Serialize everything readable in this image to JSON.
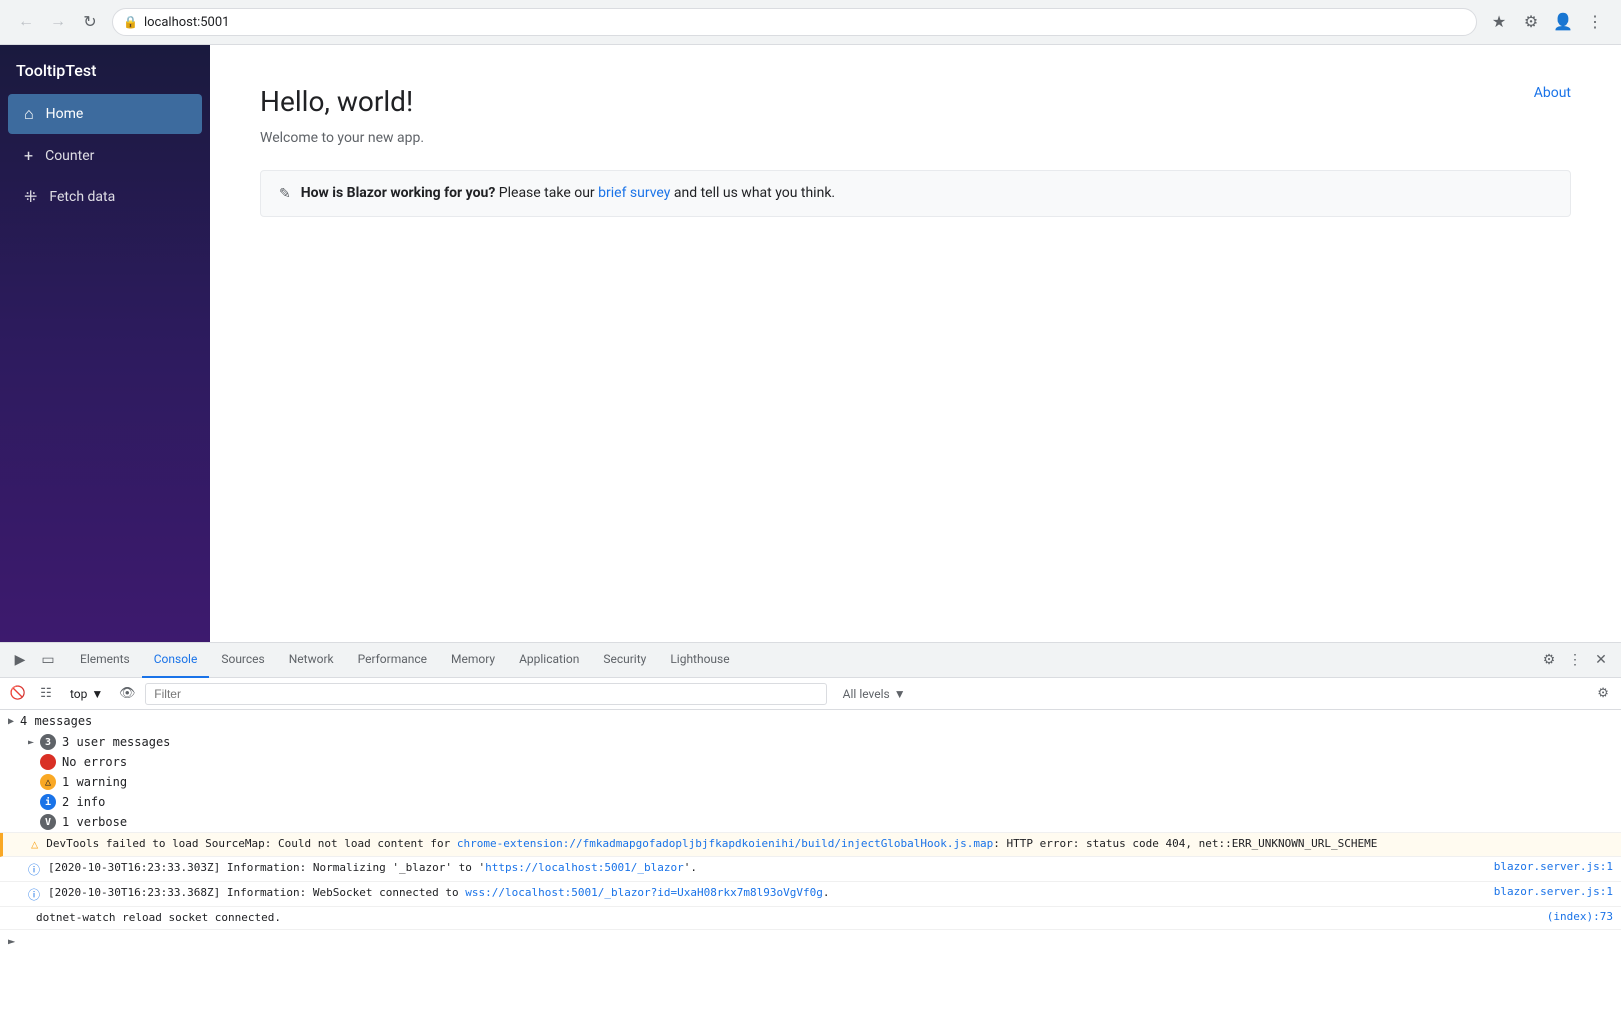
{
  "browser": {
    "url": "localhost:5001",
    "back_disabled": true,
    "forward_disabled": true
  },
  "app": {
    "title": "TooltipTest",
    "about_link": "About"
  },
  "sidebar": {
    "items": [
      {
        "id": "home",
        "icon": "⌂",
        "label": "Home",
        "active": true
      },
      {
        "id": "counter",
        "icon": "+",
        "label": "Counter",
        "active": false
      },
      {
        "id": "fetch-data",
        "icon": "⊞",
        "label": "Fetch data",
        "active": false
      }
    ]
  },
  "main": {
    "title": "Hello, world!",
    "subtitle": "Welcome to your new app.",
    "banner": {
      "text_before": "How is Blazor working for you?",
      "text_middle": " Please take our ",
      "link_text": "brief survey",
      "link_url": "#",
      "text_after": " and tell us what you think."
    }
  },
  "devtools": {
    "tabs": [
      {
        "id": "elements",
        "label": "Elements",
        "active": false
      },
      {
        "id": "console",
        "label": "Console",
        "active": true
      },
      {
        "id": "sources",
        "label": "Sources",
        "active": false
      },
      {
        "id": "network",
        "label": "Network",
        "active": false
      },
      {
        "id": "performance",
        "label": "Performance",
        "active": false
      },
      {
        "id": "memory",
        "label": "Memory",
        "active": false
      },
      {
        "id": "application",
        "label": "Application",
        "active": false
      },
      {
        "id": "security",
        "label": "Security",
        "active": false
      },
      {
        "id": "lighthouse",
        "label": "Lighthouse",
        "active": false
      }
    ],
    "console": {
      "context": "top",
      "filter_placeholder": "Filter",
      "levels": "All levels",
      "groups": [
        {
          "id": "group-4-messages",
          "label": "4 messages",
          "expanded": false
        }
      ],
      "sub_messages": [
        {
          "id": "sub-3-user",
          "badge_type": "grey",
          "badge_count": "3",
          "label": "3 user messages"
        },
        {
          "id": "sub-no-errors",
          "badge_type": "red",
          "badge_count": "0",
          "label": "No errors"
        },
        {
          "id": "sub-1-warning",
          "badge_type": "yellow",
          "badge_count": "1",
          "label": "1 warning"
        },
        {
          "id": "sub-2-info",
          "badge_type": "blue",
          "badge_count": "2",
          "label": "2 info"
        },
        {
          "id": "sub-1-verbose",
          "badge_type": "grey",
          "badge_count": "1",
          "label": "1 verbose"
        }
      ],
      "messages": [
        {
          "id": "msg-warning",
          "type": "warning",
          "content": "DevTools failed to load SourceMap: Could not load content for chrome-extension://fmkadmapgofadopljbjfkapdkoienihi/build/injectGlobalHook.js.map: HTTP error: status code 404, net::ERR_UNKNOWN_URL_SCHEME",
          "link_text": "chrome-extension://fmkadmapgofadopljbjfkapdkoienihi/build/injectGlobalHook.js.map",
          "source": ""
        },
        {
          "id": "msg-info-1",
          "type": "info",
          "content": "[2020-10-30T16:23:33.303Z] Information: Normalizing '_blazor' to '",
          "link_text": "https://localhost:5001/_blazor",
          "content_after": "'.",
          "source": "blazor.server.js:1"
        },
        {
          "id": "msg-info-2",
          "type": "info",
          "content": "[2020-10-30T16:23:33.368Z] Information: WebSocket connected to ",
          "link_text": "wss://localhost:5001/_blazor?id=UxaH08rkx7m8l93oVgVf0g",
          "content_after": ".",
          "source": "blazor.server.js:1"
        },
        {
          "id": "msg-info-3",
          "type": "info",
          "content": "dotnet-watch reload socket connected.",
          "source": "(index):73"
        }
      ]
    }
  }
}
